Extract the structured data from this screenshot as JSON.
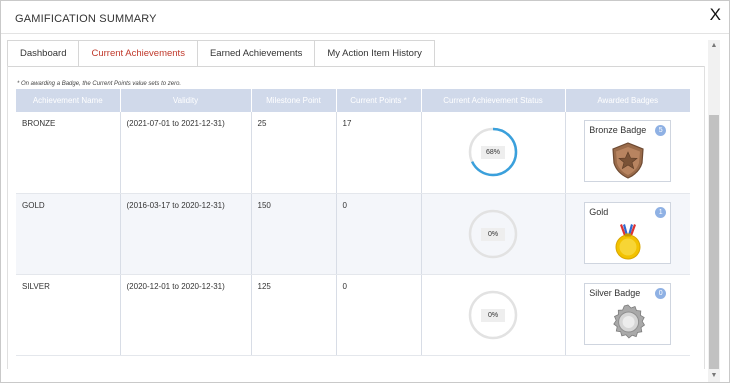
{
  "window": {
    "title": "GAMIFICATION SUMMARY",
    "close_label": "X"
  },
  "tabs": [
    {
      "label": "Dashboard",
      "active": false
    },
    {
      "label": "Current Achievements",
      "active": true
    },
    {
      "label": "Earned Achievements",
      "active": false
    },
    {
      "label": "My Action Item History",
      "active": false
    }
  ],
  "note": "* On awarding a Badge, the Current Points value sets to zero.",
  "table": {
    "headers": [
      "Achievement Name",
      "Validity",
      "Milestone Point",
      "Current Points *",
      "Current Achievement Status",
      "Awarded Badges"
    ],
    "rows": [
      {
        "name": "BRONZE",
        "validity": "(2021-07-01 to 2021-12-31)",
        "milestone": "25",
        "current": "17",
        "status_label": "68%",
        "status_progress": 0.68,
        "badge_name": "Bronze Badge",
        "badge_count": "5",
        "badge_icon": "bronze-star-shield-icon"
      },
      {
        "name": "GOLD",
        "validity": "(2016-03-17 to 2020-12-31)",
        "milestone": "150",
        "current": "0",
        "status_label": "0%",
        "status_progress": 0,
        "badge_name": "Gold",
        "badge_count": "1",
        "badge_icon": "gold-medal-icon"
      },
      {
        "name": "SILVER",
        "validity": "(2020-12-01 to 2020-12-31)",
        "milestone": "125",
        "current": "0",
        "status_label": "0%",
        "status_progress": 0,
        "badge_name": "Silver Badge",
        "badge_count": "0",
        "badge_icon": "silver-seal-icon"
      }
    ]
  },
  "colors": {
    "accent_tab": "#c0392b",
    "header_bg": "#d0d9ea",
    "progress": "#3aa0dc",
    "ring_track": "#e2e2e2",
    "count_badge": "#8fb1e4"
  }
}
